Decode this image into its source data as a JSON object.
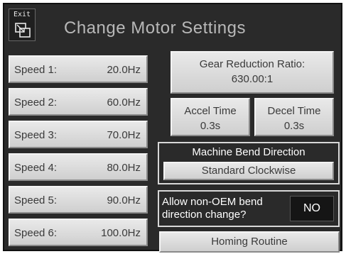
{
  "header": {
    "exit_label": "Exit",
    "title": "Change Motor Settings"
  },
  "speeds": [
    {
      "label": "Speed 1:",
      "value": "20.0Hz"
    },
    {
      "label": "Speed 2:",
      "value": "60.0Hz"
    },
    {
      "label": "Speed 3:",
      "value": "70.0Hz"
    },
    {
      "label": "Speed 4:",
      "value": "80.0Hz"
    },
    {
      "label": "Speed 5:",
      "value": "90.0Hz"
    },
    {
      "label": "Speed 6:",
      "value": "100.0Hz"
    }
  ],
  "gear": {
    "label": "Gear Reduction Ratio:",
    "value": "630.00:1"
  },
  "accel": {
    "label": "Accel Time",
    "value": "0.3s"
  },
  "decel": {
    "label": "Decel Time",
    "value": "0.3s"
  },
  "bend_direction": {
    "title": "Machine Bend Direction",
    "value": "Standard Clockwise"
  },
  "allow_change": {
    "label_line1": "Allow non-OEM bend",
    "label_line2": "direction change?",
    "value": "NO"
  },
  "homing": {
    "label": "Homing Routine"
  },
  "icons": {
    "exit": "exit-window-icon"
  },
  "colors": {
    "panel_background": "#2a2a2a",
    "button_face": "#dcdcdc",
    "title_text": "#b8b8b8"
  }
}
